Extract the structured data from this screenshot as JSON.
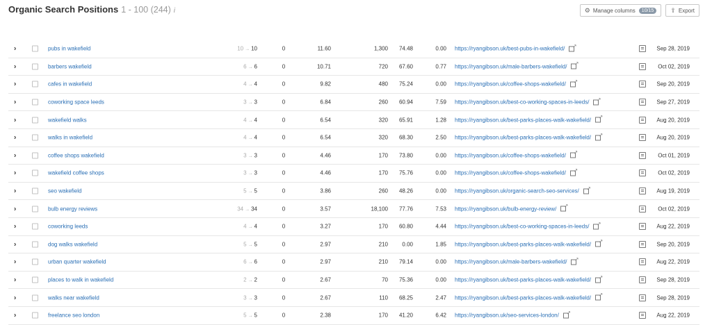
{
  "header": {
    "title": "Organic Search Positions",
    "range": "1 - 100 (244)",
    "info_glyph": "i"
  },
  "toolbar": {
    "manage_label": "Manage columns",
    "columns_badge": "10/15",
    "export_label": "Export"
  },
  "colors": {
    "link": "#2a6fb5",
    "muted": "#999999",
    "border": "#e6e6e6"
  },
  "icons": [
    "gear-icon",
    "export-icon",
    "chevron-right-icon",
    "checkbox",
    "external-link-icon",
    "serp-snapshot-icon"
  ],
  "rows": [
    {
      "keyword": "pubs in wakefield",
      "prev": "10",
      "pos": "10",
      "diff": "0",
      "kd": "11.60",
      "volume": "1,300",
      "cpc": "74.48",
      "comp": "0.00",
      "url": "https://ryangibson.uk/best-pubs-in-wakefield/",
      "date": "Sep 28, 2019"
    },
    {
      "keyword": "barbers wakefield",
      "prev": "6",
      "pos": "6",
      "diff": "0",
      "kd": "10.71",
      "volume": "720",
      "cpc": "67.60",
      "comp": "0.77",
      "url": "https://ryangibson.uk/male-barbers-wakefield/",
      "date": "Oct 02, 2019"
    },
    {
      "keyword": "cafes in wakefield",
      "prev": "4",
      "pos": "4",
      "diff": "0",
      "kd": "9.82",
      "volume": "480",
      "cpc": "75.24",
      "comp": "0.00",
      "url": "https://ryangibson.uk/coffee-shops-wakefield/",
      "date": "Sep 20, 2019"
    },
    {
      "keyword": "coworking space leeds",
      "prev": "3",
      "pos": "3",
      "diff": "0",
      "kd": "6.84",
      "volume": "260",
      "cpc": "60.94",
      "comp": "7.59",
      "url": "https://ryangibson.uk/best-co-working-spaces-in-leeds/",
      "date": "Sep 27, 2019"
    },
    {
      "keyword": "wakefield walks",
      "prev": "4",
      "pos": "4",
      "diff": "0",
      "kd": "6.54",
      "volume": "320",
      "cpc": "65.91",
      "comp": "1.28",
      "url": "https://ryangibson.uk/best-parks-places-walk-wakefield/",
      "date": "Aug 20, 2019"
    },
    {
      "keyword": "walks in wakefield",
      "prev": "4",
      "pos": "4",
      "diff": "0",
      "kd": "6.54",
      "volume": "320",
      "cpc": "68.30",
      "comp": "2.50",
      "url": "https://ryangibson.uk/best-parks-places-walk-wakefield/",
      "date": "Aug 20, 2019"
    },
    {
      "keyword": "coffee shops wakefield",
      "prev": "3",
      "pos": "3",
      "diff": "0",
      "kd": "4.46",
      "volume": "170",
      "cpc": "73.80",
      "comp": "0.00",
      "url": "https://ryangibson.uk/coffee-shops-wakefield/",
      "date": "Oct 01, 2019"
    },
    {
      "keyword": "wakefield coffee shops",
      "prev": "3",
      "pos": "3",
      "diff": "0",
      "kd": "4.46",
      "volume": "170",
      "cpc": "75.76",
      "comp": "0.00",
      "url": "https://ryangibson.uk/coffee-shops-wakefield/",
      "date": "Oct 02, 2019"
    },
    {
      "keyword": "seo wakefield",
      "prev": "5",
      "pos": "5",
      "diff": "0",
      "kd": "3.86",
      "volume": "260",
      "cpc": "48.26",
      "comp": "0.00",
      "url": "https://ryangibson.uk/organic-search-seo-services/",
      "date": "Aug 19, 2019"
    },
    {
      "keyword": "bulb energy reviews",
      "prev": "34",
      "pos": "34",
      "diff": "0",
      "kd": "3.57",
      "volume": "18,100",
      "cpc": "77.76",
      "comp": "7.53",
      "url": "https://ryangibson.uk/bulb-energy-review/",
      "date": "Oct 02, 2019"
    },
    {
      "keyword": "coworking leeds",
      "prev": "4",
      "pos": "4",
      "diff": "0",
      "kd": "3.27",
      "volume": "170",
      "cpc": "60.80",
      "comp": "4.44",
      "url": "https://ryangibson.uk/best-co-working-spaces-in-leeds/",
      "date": "Aug 22, 2019"
    },
    {
      "keyword": "dog walks wakefield",
      "prev": "5",
      "pos": "5",
      "diff": "0",
      "kd": "2.97",
      "volume": "210",
      "cpc": "0.00",
      "comp": "1.85",
      "url": "https://ryangibson.uk/best-parks-places-walk-wakefield/",
      "date": "Sep 20, 2019"
    },
    {
      "keyword": "urban quarter wakefield",
      "prev": "6",
      "pos": "6",
      "diff": "0",
      "kd": "2.97",
      "volume": "210",
      "cpc": "79.14",
      "comp": "0.00",
      "url": "https://ryangibson.uk/male-barbers-wakefield/",
      "date": "Aug 22, 2019"
    },
    {
      "keyword": "places to walk in wakefield",
      "prev": "2",
      "pos": "2",
      "diff": "0",
      "kd": "2.67",
      "volume": "70",
      "cpc": "75.36",
      "comp": "0.00",
      "url": "https://ryangibson.uk/best-parks-places-walk-wakefield/",
      "date": "Sep 28, 2019"
    },
    {
      "keyword": "walks near wakefield",
      "prev": "3",
      "pos": "3",
      "diff": "0",
      "kd": "2.67",
      "volume": "110",
      "cpc": "68.25",
      "comp": "2.47",
      "url": "https://ryangibson.uk/best-parks-places-walk-wakefield/",
      "date": "Sep 28, 2019"
    },
    {
      "keyword": "freelance seo london",
      "prev": "5",
      "pos": "5",
      "diff": "0",
      "kd": "2.38",
      "volume": "170",
      "cpc": "41.20",
      "comp": "6.42",
      "url": "https://ryangibson.uk/seo-services-london/",
      "date": "Aug 22, 2019"
    }
  ]
}
